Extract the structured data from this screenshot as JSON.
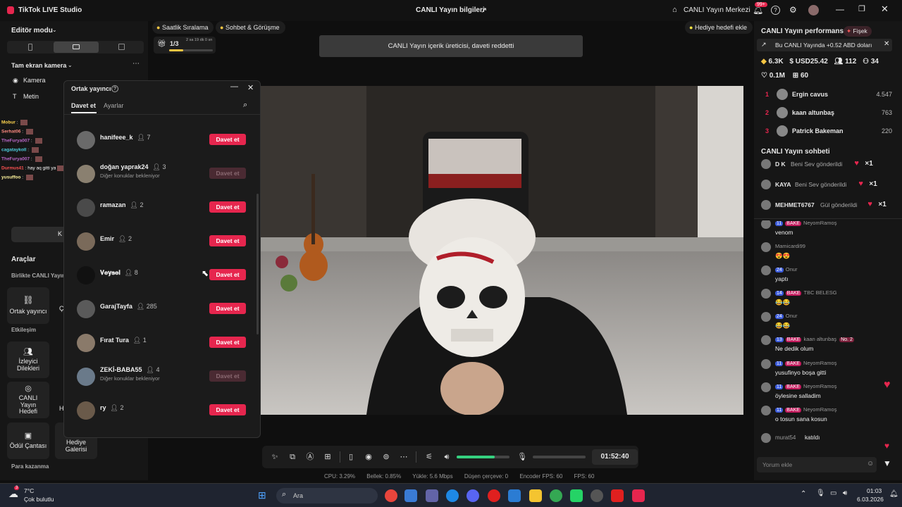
{
  "titlebar": {
    "app_title": "TikTok LIVE Studio",
    "center_title": "CANLI Yayın bilgileri",
    "live_center": "CANLI Yayın Merkezi",
    "notif_badge": "99+"
  },
  "left": {
    "editor_mode": "Editör modu",
    "fullscreen_camera": "Tam ekran kamera",
    "sources": [
      "Kamera",
      "Metin"
    ],
    "tools_heading": "Araçlar",
    "collab_heading": "Birlikte CANLI Yayın",
    "cohost_label": "Ortak yayıncı",
    "engagement_heading": "Etkileşim",
    "viewer_wishes": "İzleyici Dilekleri",
    "live_goal": "CANLI Yayın Hedefi",
    "reward_bag": "Ödül Çantası",
    "gift_gallery": "Hediye Galerisi",
    "earn_heading": "Para kazanma",
    "partial_button": "K",
    "partial_c": "Ç",
    "partial_h1": "H",
    "partial_h2": "H"
  },
  "overlay_chat": [
    {
      "name": "Mobur",
      "color": "#ffd54f"
    },
    {
      "name": "Serhat06",
      "color": "#ff8a80"
    },
    {
      "name": "TheFurya007",
      "color": "#ba68c8"
    },
    {
      "name": "cagataykoll",
      "color": "#4dd0e1"
    },
    {
      "name": "TheFurya007",
      "color": "#ba68c8"
    },
    {
      "name": "Durmus41",
      "color": "#ff5252",
      "text": "hay aq gitti ya"
    },
    {
      "name": "yusuffoo",
      "color": "#fff59d"
    }
  ],
  "popup": {
    "title": "Ortak yayıncı",
    "tabs": [
      "Davet et",
      "Ayarlar"
    ],
    "rows": [
      {
        "name": "hanifeee_k",
        "count": "7",
        "button": "Davet et",
        "disabled": false
      },
      {
        "name": "doğan yaprak24",
        "count": "3",
        "sub": "Diğer konuklar bekleniyor",
        "button": "Davet et",
        "disabled": true
      },
      {
        "name": "ramazan",
        "count": "2",
        "button": "Davet et",
        "disabled": false
      },
      {
        "name": "Emir",
        "count": "2",
        "button": "Davet et",
        "disabled": false
      },
      {
        "name": "𝐕𝐞𝐲𝐬𝐞𝐥",
        "count": "8",
        "button": "Davet et",
        "disabled": false
      },
      {
        "name": "GarajTayfa",
        "count": "285",
        "button": "Davet et",
        "disabled": false
      },
      {
        "name": "Fırat Tura",
        "count": "1",
        "button": "Davet et",
        "disabled": false
      },
      {
        "name": "ZEKİ-BABA55",
        "count": "4",
        "sub": "Diğer konuklar bekleniyor",
        "button": "Davet et",
        "disabled": true
      },
      {
        "name": "ry",
        "count": "2",
        "button": "Davet et",
        "disabled": false
      }
    ]
  },
  "top_pills": {
    "hourly_rank": "Saatlik Sıralama",
    "chat_meet": "Sohbet & Görüşme",
    "gift_goal": "Hediye hedefi ekle",
    "progress_label": "1/3",
    "progress_time": "2 sa 19 dk 0 sn",
    "progress_value": 0.33
  },
  "toast": "CANLI Yayın içerik üreticisi, daveti reddetti",
  "right": {
    "perf_title": "CANLI Yayın performansı",
    "firework": "Fişek",
    "earning_banner": "Bu CANLI Yayında +0.52 ABD doları",
    "stats": {
      "diamonds": "6.3K",
      "usd": "USD25.42",
      "viewers": "112",
      "new": "34",
      "likes": "0.1M",
      "gifters": "60"
    },
    "ranking": [
      {
        "rank": "1",
        "name": "Ergin cavus",
        "score": "4.547"
      },
      {
        "rank": "2",
        "name": "kaan altunbaş",
        "score": "763"
      },
      {
        "rank": "3",
        "name": "Patrick Bakeman",
        "score": "220"
      }
    ],
    "chat_title": "CANLI Yayın sohbeti",
    "gifts": [
      {
        "user": "D K",
        "text": "Beni Sev gönderildi",
        "mult": "×1"
      },
      {
        "user": "KAYA",
        "text": "Beni Sev gönderildi",
        "mult": "×1"
      },
      {
        "user": "MEHMET6767",
        "text": "Gül gönderildi",
        "mult": "×1"
      }
    ],
    "messages": [
      {
        "lvl": "11",
        "fan": "BAKE",
        "user": "NeyomRamoş",
        "text": "venom"
      },
      {
        "user": "Mamicardi99",
        "text": "😍😍"
      },
      {
        "lvl": "24",
        "user": "Onur",
        "text": "yaptı"
      },
      {
        "lvl": "14",
        "fan": "BAKE",
        "user": "TBC BELESG",
        "text": "😂😂"
      },
      {
        "lvl": "24",
        "user": "Onur",
        "text": "😂😂"
      },
      {
        "lvl": "13",
        "fan": "BAKE",
        "user": "kaan altunbaş",
        "badge": "No. 2",
        "text": "Ne dedik olum"
      },
      {
        "lvl": "11",
        "fan": "BAKE",
        "user": "NeyomRamoş",
        "text": "yusufinyo boşa gitti"
      },
      {
        "lvl": "11",
        "fan": "BAKE",
        "user": "NeyomRamoş",
        "text": "öylesine salladim"
      },
      {
        "lvl": "11",
        "fan": "BAKE",
        "user": "NeyomRamoş",
        "text": "o tosun sana kosun"
      }
    ],
    "joined": {
      "user": "murat54",
      "text": "katıldı"
    },
    "comment_placeholder": "Yorum ekle"
  },
  "controls": {
    "timer": "01:52:40",
    "volume": 0.72
  },
  "stats_bar": {
    "cpu": "CPU:  3.29%",
    "memory": "Bellek:  0.85%",
    "upload": "Yükle:  5.6 Mbps",
    "dropped": "Düşen çerçeve:  0",
    "encoder": "Encoder FPS:  60",
    "fps": "FPS:  60"
  },
  "taskbar": {
    "temp": "7°C",
    "weather": "Çok bulutlu",
    "weather_badge": "3",
    "search": "Ara",
    "time": "01:03",
    "date": "6.03.2026"
  }
}
